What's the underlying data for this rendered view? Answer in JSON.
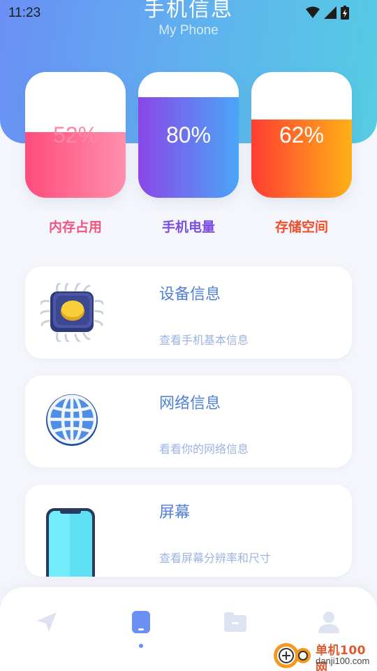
{
  "status_bar": {
    "time": "11:23"
  },
  "header": {
    "title": "手机信息",
    "subtitle": "My Phone"
  },
  "gauges": [
    {
      "value_text": "52%",
      "label": "内存占用",
      "fill_fraction": 0.52,
      "label_color": "#f0557f"
    },
    {
      "value_text": "80%",
      "label": "手机电量",
      "fill_fraction": 0.8,
      "label_color": "#7a4fe2"
    },
    {
      "value_text": "62%",
      "label": "存储空间",
      "fill_fraction": 0.62,
      "label_color": "#ef4e2c"
    }
  ],
  "cards": [
    {
      "title": "设备信息",
      "desc": "查看手机基本信息",
      "icon": "chip-icon"
    },
    {
      "title": "网络信息",
      "desc": "看看你的网络信息",
      "icon": "globe-icon"
    },
    {
      "title": "屏幕",
      "desc": "查看屏幕分辨率和尺寸",
      "icon": "phone-screen-icon"
    }
  ],
  "bottom_nav": {
    "items": [
      "navigate-icon",
      "phone-icon",
      "folder-icon",
      "user-icon"
    ],
    "active_index": 1,
    "active_color": "#6a8ff5",
    "inactive_color": "#dde3f0"
  },
  "watermark": {
    "name": "单机100网",
    "url": "danji100.com"
  }
}
